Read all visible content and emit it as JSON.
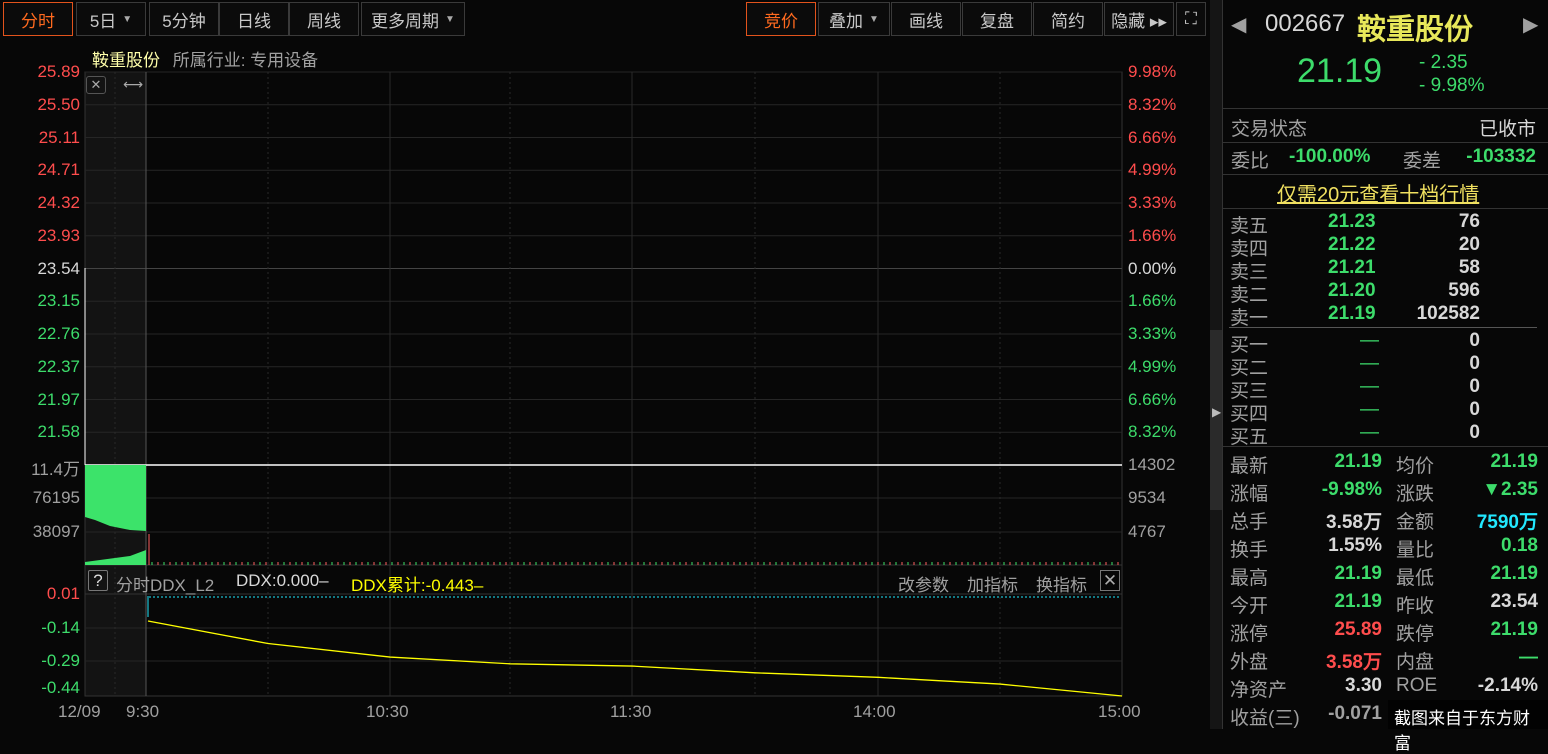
{
  "toolbar": {
    "left": [
      {
        "label": "分时",
        "active": true
      },
      {
        "label": "5日",
        "dropdown": true
      },
      {
        "label": "5分钟"
      },
      {
        "label": "日线"
      },
      {
        "label": "周线"
      },
      {
        "label": "更多周期",
        "dropdown": true
      }
    ],
    "right": [
      {
        "label": "竞价",
        "active": true
      },
      {
        "label": "叠加",
        "dropdown": true
      },
      {
        "label": "画线"
      },
      {
        "label": "复盘"
      },
      {
        "label": "简约"
      },
      {
        "label": "隐藏 ▸▸"
      }
    ],
    "fullscreen_icon": "expand-icon"
  },
  "chart_header": {
    "name": "鞍重股份",
    "industry": "所属行业: 专用设备"
  },
  "chart_data": [
    {
      "type": "line",
      "title": "分时",
      "y_left_ticks": [
        "25.89",
        "25.50",
        "25.11",
        "24.71",
        "24.32",
        "23.93",
        "23.54",
        "23.15",
        "22.76",
        "22.37",
        "21.97",
        "21.58"
      ],
      "y_right_ticks": [
        "9.98%",
        "8.32%",
        "6.66%",
        "4.99%",
        "3.33%",
        "1.66%",
        "0.00%",
        "1.66%",
        "3.33%",
        "4.99%",
        "6.66%",
        "8.32%"
      ],
      "ylim": [
        21.19,
        25.89
      ],
      "prev_close": 23.54,
      "x": [
        "9:30",
        "15:00"
      ],
      "price": [
        21.19,
        21.19
      ]
    },
    {
      "type": "bar",
      "title": "成交量",
      "y_left_ticks": [
        "11.4万",
        "76195",
        "38097"
      ],
      "y_right_ticks": [
        "14302",
        "9534",
        "4767"
      ]
    },
    {
      "type": "line",
      "title": "分时DDX_L2",
      "ddx_label": "DDX:0.000–",
      "ddx_cum_label": "DDX累计:-0.443–",
      "y_ticks": [
        "0.01",
        "-0.14",
        "-0.29",
        "-0.44"
      ],
      "ylim": [
        -0.443,
        0.01
      ],
      "x": [
        "9:31",
        "10:00",
        "10:30",
        "11:00",
        "11:30",
        "13:30",
        "14:00",
        "14:30",
        "15:00"
      ],
      "ddx_cum": [
        -0.11,
        -0.21,
        -0.27,
        -0.3,
        -0.31,
        -0.34,
        -0.36,
        -0.39,
        -0.443
      ]
    }
  ],
  "ddx_buttons": [
    "改参数",
    "加指标",
    "换指标"
  ],
  "x_axis": [
    "12/09",
    "9:30",
    "10:30",
    "11:30",
    "14:00",
    "15:00"
  ],
  "quote": {
    "code": "002667",
    "name": "鞍重股份",
    "price": "21.19",
    "change": "- 2.35",
    "pct": "- 9.98%",
    "status_label": "交易状态",
    "status": "已收市",
    "wb_label": "委比",
    "wb": "-100.00%",
    "wc_label": "委差",
    "wc": "-103332",
    "promo": "仅需20元查看十档行情"
  },
  "asks": [
    {
      "l": "卖五",
      "p": "21.23",
      "v": "76"
    },
    {
      "l": "卖四",
      "p": "21.22",
      "v": "20"
    },
    {
      "l": "卖三",
      "p": "21.21",
      "v": "58"
    },
    {
      "l": "卖二",
      "p": "21.20",
      "v": "596"
    },
    {
      "l": "卖一",
      "p": "21.19",
      "v": "102582"
    }
  ],
  "bids": [
    {
      "l": "买一",
      "p": "—",
      "v": "0"
    },
    {
      "l": "买二",
      "p": "—",
      "v": "0"
    },
    {
      "l": "买三",
      "p": "—",
      "v": "0"
    },
    {
      "l": "买四",
      "p": "—",
      "v": "0"
    },
    {
      "l": "买五",
      "p": "—",
      "v": "0"
    }
  ],
  "stats": [
    [
      "最新",
      "21.19",
      "均价",
      "21.19"
    ],
    [
      "涨幅",
      "-9.98%",
      "涨跌",
      "▼2.35"
    ],
    [
      "总手",
      "3.58万",
      "金额",
      "7590万"
    ],
    [
      "换手",
      "1.55%",
      "量比",
      "0.18"
    ],
    [
      "最高",
      "21.19",
      "最低",
      "21.19"
    ],
    [
      "今开",
      "21.19",
      "昨收",
      "23.54"
    ],
    [
      "涨停",
      "25.89",
      "跌停",
      "21.19"
    ],
    [
      "外盘",
      "3.58万",
      "内盘",
      "—"
    ],
    [
      "净资产",
      "3.30",
      "ROE",
      "-2.14%"
    ],
    [
      "收益(三)",
      "-0.071",
      "",
      ""
    ]
  ],
  "watermark": "截图来自于东方财富",
  "colors": {
    "up": "#ff4d4d",
    "down": "#3ddc6b",
    "accent": "#ff6a1f",
    "ddx": "#ffff00"
  }
}
